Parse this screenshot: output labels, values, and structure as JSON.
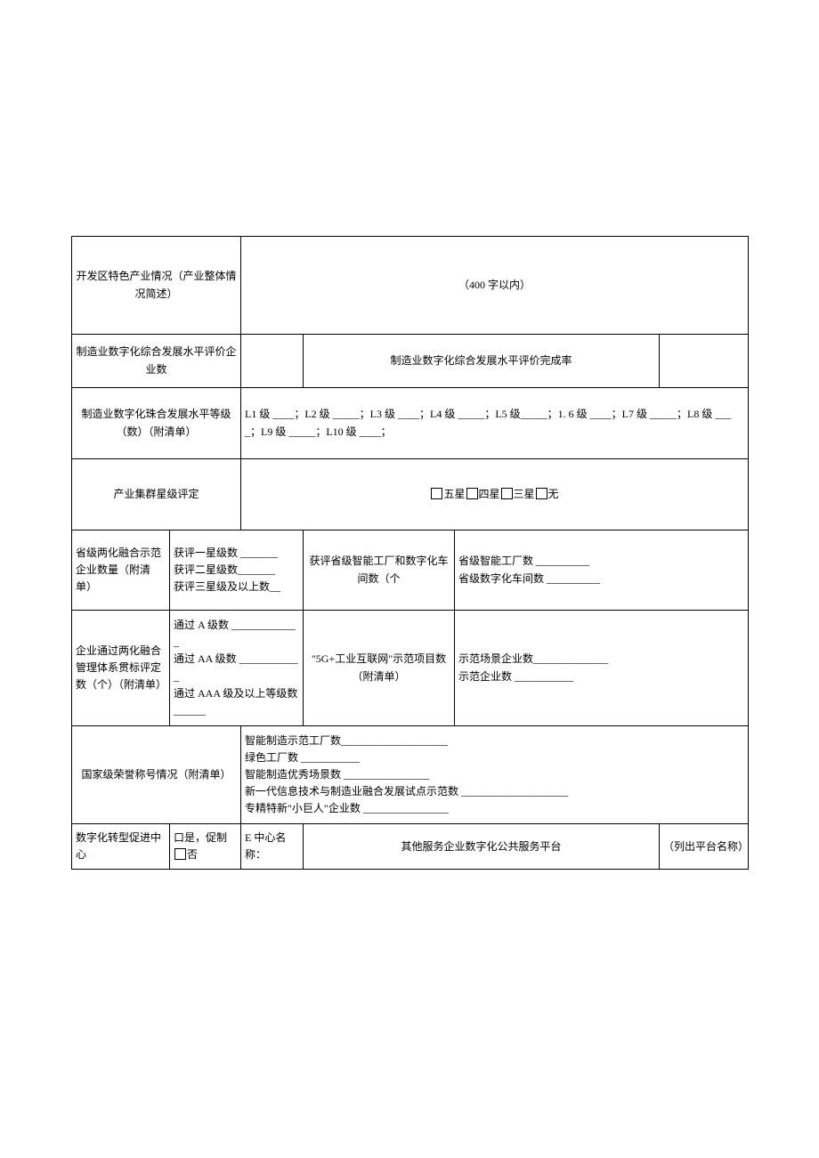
{
  "row1": {
    "label": "开发区特色产业情况（产业整体情况简述）",
    "value": "（400 字以内）"
  },
  "row2": {
    "label1": "制造业数字化综合发展水平评价企业数",
    "label2": "制造业数字化综合发展水平评价完成率"
  },
  "row3": {
    "label": "制造业数字化珠合发展水平等级（数）（附清单）",
    "text": "L1 级 ____；L2 级 _____；L3 级 ____；L4 级 _____；L5 级_____；1. 6 级 ____；L7 级 _____；L8 级 ____；L9 级 _____；L10 级 ____；"
  },
  "row4": {
    "label": "产业集群星级评定",
    "opt1": "五星",
    "opt2": "四星",
    "opt3": "三星",
    "opt4": "无"
  },
  "row5": {
    "c1": "省级两化融合示范企业数量（附清单）",
    "c2a": "获评一星级数 _______",
    "c2b": "获评二星级数_______",
    "c2c": "获评三星级及以上数__",
    "c3": "获评省级智能工厂和数字化车间数（个",
    "c4a": "省级智能工厂数 __________",
    "c4b": "省级数字化车间数 __________"
  },
  "row6": {
    "c1": "企业通过两化融合管理体系贯标评定数（个）（附清单）",
    "c2a": "通过 A 级数 _____________",
    "c2b": "通过 AA 级数 ____________",
    "c2c": "通过 AAA 级及以上等级数 ______",
    "c3": "\"5G+工业互联网\"示范项目数（附清单）",
    "c4a": "示范场景企业数______________",
    "c4b": "示范企业数 ___________"
  },
  "row7": {
    "label": "国家级荣誉称号情况（附清单）",
    "l1": "智能制造示范工厂数____________________",
    "l2": "绿色工厂数 ___________",
    "l3": "智能制造优秀场景数 ________________",
    "l4": "新一代信息技术与制造业融合发展试点示范数 ____________________",
    "l5": "专精特新\"小巨人\"企业数 ________________"
  },
  "row8": {
    "c1": "数字化转型促进中心",
    "c2a": "口是，促制",
    "c2b": "否",
    "c3": "E 中心名称：",
    "c4": "其他服务企业数字化公共服务平台",
    "c5": "（列出平台名称）"
  }
}
